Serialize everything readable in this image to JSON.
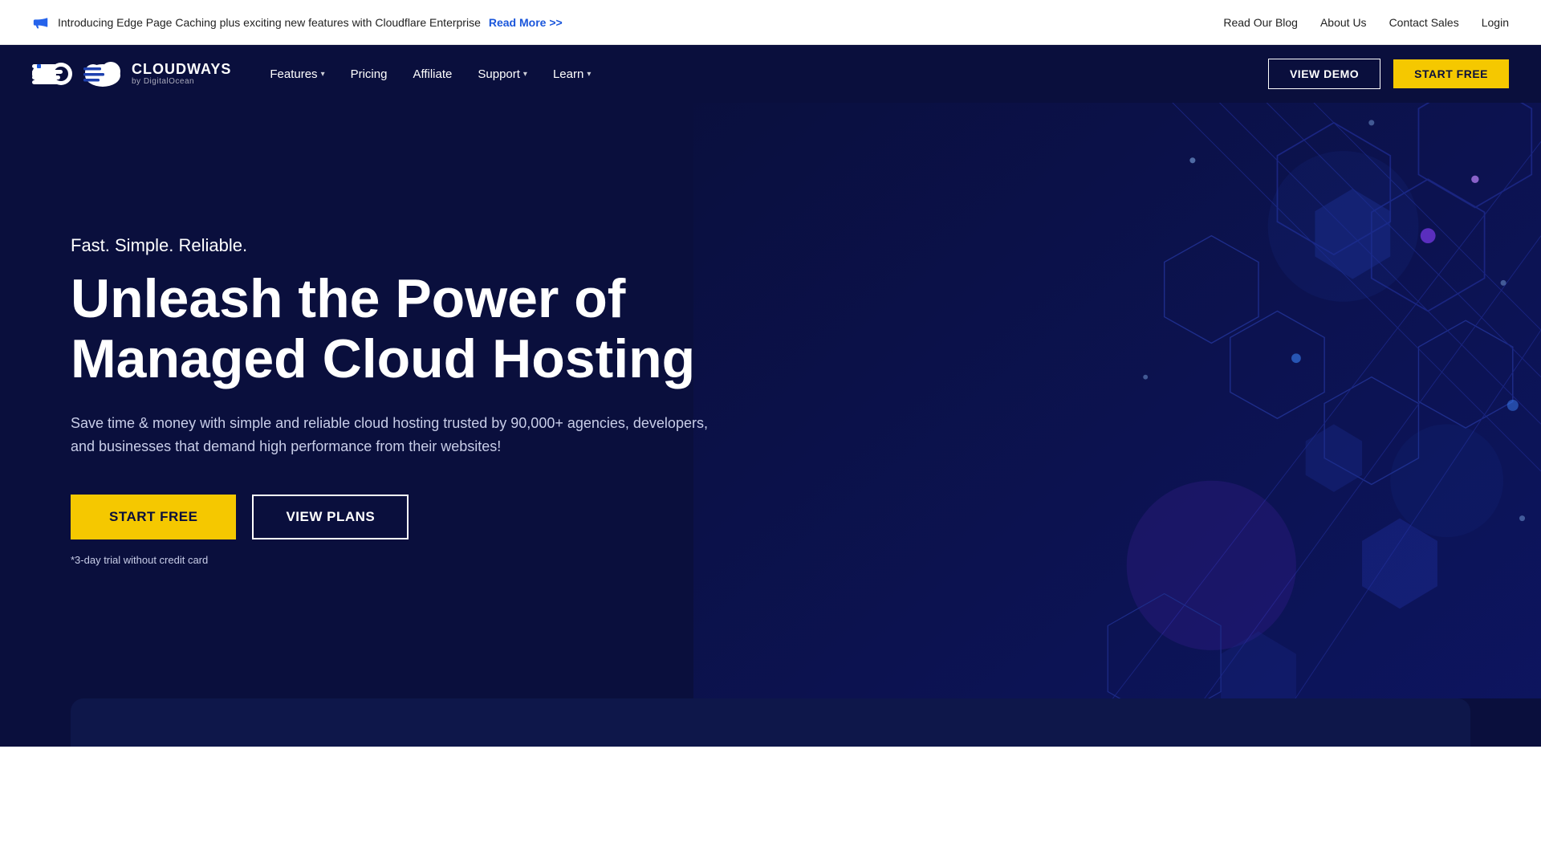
{
  "topbar": {
    "announcement": "Introducing Edge Page Caching plus exciting new features with Cloudflare Enterprise",
    "read_more_label": "Read More >>",
    "links": [
      {
        "id": "read-our-blog",
        "label": "Read Our Blog"
      },
      {
        "id": "about-us",
        "label": "About Us"
      },
      {
        "id": "contact-sales",
        "label": "Contact Sales"
      },
      {
        "id": "login",
        "label": "Login"
      }
    ]
  },
  "navbar": {
    "logo": {
      "brand": "CLOUDWAYS",
      "sub": "by DigitalOcean"
    },
    "nav_links": [
      {
        "id": "features",
        "label": "Features",
        "has_dropdown": true
      },
      {
        "id": "pricing",
        "label": "Pricing",
        "has_dropdown": false
      },
      {
        "id": "affiliate",
        "label": "Affiliate",
        "has_dropdown": false
      },
      {
        "id": "support",
        "label": "Support",
        "has_dropdown": true
      },
      {
        "id": "learn",
        "label": "Learn",
        "has_dropdown": true
      }
    ],
    "view_demo_label": "VIEW DEMO",
    "start_free_label": "START FREE"
  },
  "hero": {
    "tagline": "Fast. Simple. Reliable.",
    "title": "Unleash the Power of Managed Cloud Hosting",
    "description": "Save time & money with simple and reliable cloud hosting trusted by 90,000+ agencies, developers, and businesses that demand high performance from their websites!",
    "start_free_label": "START FREE",
    "view_plans_label": "VIEW PLANS",
    "trial_note": "*3-day trial without credit card"
  },
  "colors": {
    "bg_dark": "#0a0f3d",
    "accent_yellow": "#f5c800",
    "text_light": "#c8cde8"
  }
}
